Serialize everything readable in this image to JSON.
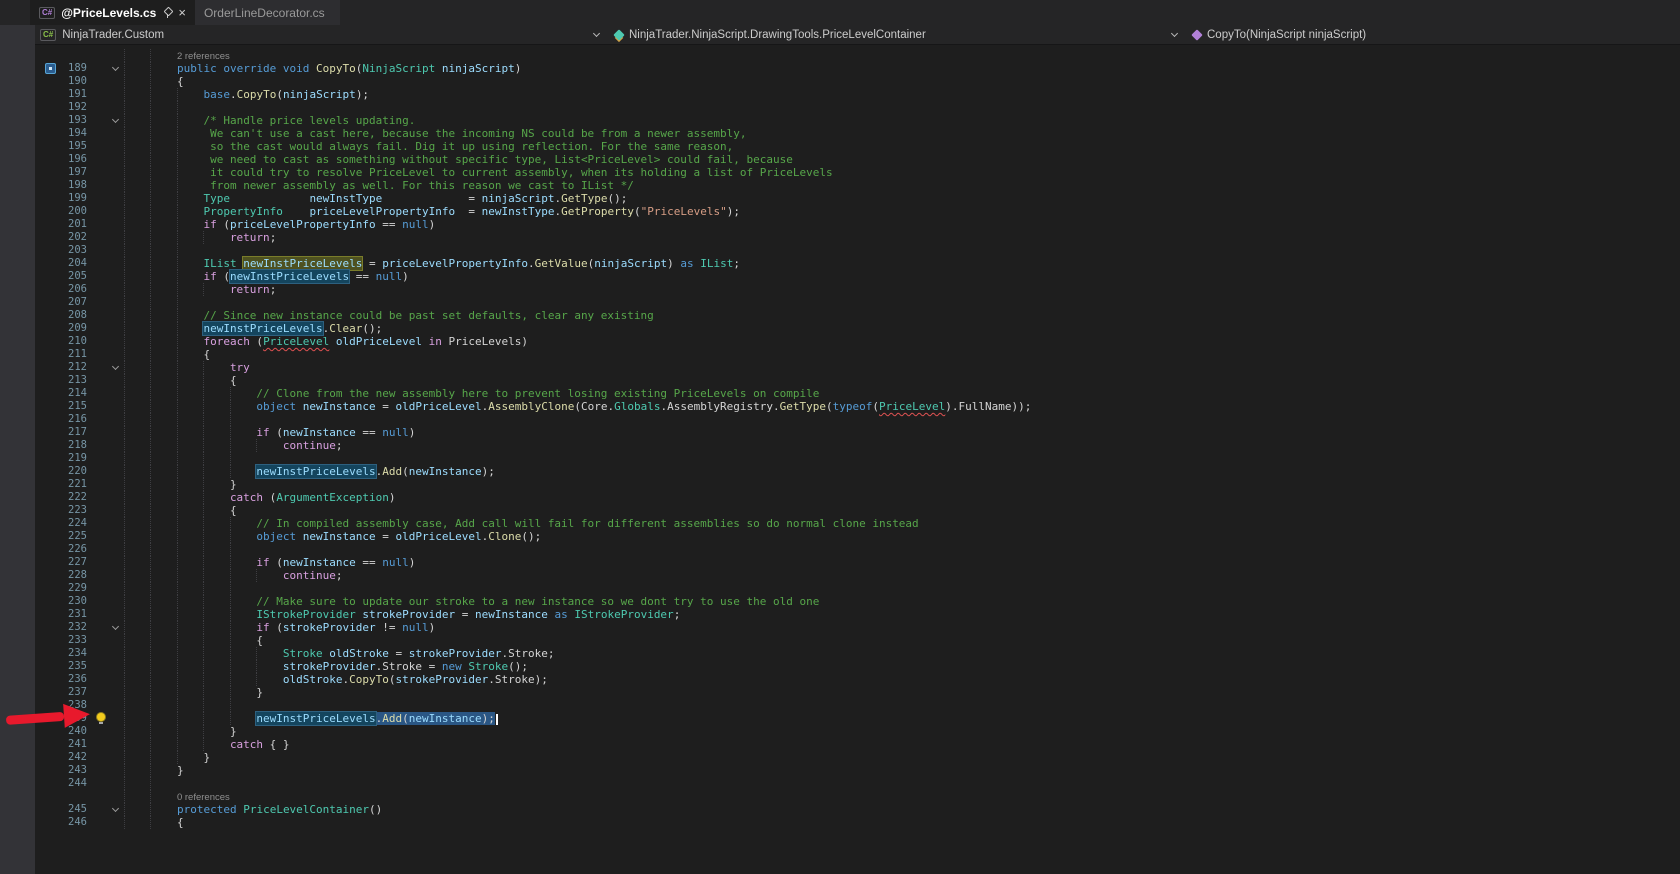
{
  "tabs": [
    {
      "label": "@PriceLevels.cs",
      "icon": "C#",
      "close_glyph": "×",
      "active": true,
      "pinned": true
    },
    {
      "label": "OrderLineDecorator.cs",
      "active": false
    }
  ],
  "navbar": {
    "project_icon": "C#",
    "project": "NinjaTrader.Custom",
    "type": "NinjaTrader.NinjaScript.DrawingTools.PriceLevelContainer",
    "member": "CopyTo(NinjaScript ninjaScript)"
  },
  "colors": {
    "red_arrow": "#e8192c",
    "selection": "#2a5684",
    "reference_highlight": "#14455e",
    "definition_highlight": "#4e5120",
    "comment": "#57a64a",
    "keyword": "#569cd6",
    "control_keyword": "#d8a0df",
    "type": "#4ec9b0",
    "method": "#dcdcaa",
    "variable": "#9cdcfe"
  },
  "editor": {
    "rows": [
      {
        "ann": "2 references",
        "ind": 2
      },
      {
        "n": 189,
        "fold": 1,
        "glyph": 1,
        "ind": 2,
        "t": [
          [
            "kw",
            "public override void "
          ],
          [
            "mth",
            "CopyTo"
          ],
          [
            "pln",
            "("
          ],
          [
            "typ",
            "NinjaScript"
          ],
          [
            "pln",
            " "
          ],
          [
            "var",
            "ninjaScript"
          ],
          [
            "pln",
            ")"
          ]
        ]
      },
      {
        "n": 190,
        "ind": 2,
        "t": [
          [
            "pln",
            "{"
          ]
        ]
      },
      {
        "n": 191,
        "ind": 3,
        "t": [
          [
            "kw",
            "base"
          ],
          [
            "pln",
            "."
          ],
          [
            "mth",
            "CopyTo"
          ],
          [
            "pln",
            "("
          ],
          [
            "var",
            "ninjaScript"
          ],
          [
            "pln",
            ");"
          ]
        ]
      },
      {
        "n": 192,
        "ind": 3,
        "t": []
      },
      {
        "n": 193,
        "fold": 1,
        "ind": 3,
        "t": [
          [
            "com",
            "/* Handle price levels updating."
          ]
        ]
      },
      {
        "n": 194,
        "ind": 3,
        "t": [
          [
            "com",
            " We can't use a cast here, because the incoming NS could be from a newer assembly,"
          ]
        ]
      },
      {
        "n": 195,
        "ind": 3,
        "t": [
          [
            "com",
            " so the cast would always fail. Dig it up using reflection. For the same reason,"
          ]
        ]
      },
      {
        "n": 196,
        "ind": 3,
        "t": [
          [
            "com",
            " we need to cast as something without specific type, List<PriceLevel> could fail, because"
          ]
        ]
      },
      {
        "n": 197,
        "ind": 3,
        "t": [
          [
            "com",
            " it could try to resolve PriceLevel to current assembly, when its holding a list of PriceLevels"
          ]
        ]
      },
      {
        "n": 198,
        "ind": 3,
        "t": [
          [
            "com",
            " from newer assembly as well. For this reason we cast to IList */"
          ]
        ]
      },
      {
        "n": 199,
        "ind": 3,
        "t": [
          [
            "typ",
            "Type"
          ],
          [
            "pln",
            "            "
          ],
          [
            "var",
            "newInstType"
          ],
          [
            "pln",
            "             = "
          ],
          [
            "var",
            "ninjaScript"
          ],
          [
            "pln",
            "."
          ],
          [
            "mth",
            "GetType"
          ],
          [
            "pln",
            "();"
          ]
        ]
      },
      {
        "n": 200,
        "ind": 3,
        "t": [
          [
            "typ",
            "PropertyInfo"
          ],
          [
            "pln",
            "    "
          ],
          [
            "var",
            "priceLevelPropertyInfo"
          ],
          [
            "pln",
            "  = "
          ],
          [
            "var",
            "newInstType"
          ],
          [
            "pln",
            "."
          ],
          [
            "mth",
            "GetProperty"
          ],
          [
            "pln",
            "("
          ],
          [
            "str",
            "\"PriceLevels\""
          ],
          [
            "pln",
            ");"
          ]
        ]
      },
      {
        "n": 201,
        "ind": 3,
        "t": [
          [
            "ctl",
            "if"
          ],
          [
            "pln",
            " ("
          ],
          [
            "var",
            "priceLevelPropertyInfo"
          ],
          [
            "pln",
            " == "
          ],
          [
            "kw",
            "null"
          ],
          [
            "pln",
            ")"
          ]
        ]
      },
      {
        "n": 202,
        "ind": 4,
        "t": [
          [
            "ctl",
            "return"
          ],
          [
            "pln",
            ";"
          ]
        ]
      },
      {
        "n": 203,
        "ind": 3,
        "t": []
      },
      {
        "n": 204,
        "ind": 3,
        "t": [
          [
            "typ",
            "IList"
          ],
          [
            "pln",
            " "
          ],
          [
            "var defhl",
            "newInstPriceLevels"
          ],
          [
            "pln",
            " = "
          ],
          [
            "var",
            "priceLevelPropertyInfo"
          ],
          [
            "pln",
            "."
          ],
          [
            "mth",
            "GetValue"
          ],
          [
            "pln",
            "("
          ],
          [
            "var",
            "ninjaScript"
          ],
          [
            "pln",
            ") "
          ],
          [
            "kw",
            "as"
          ],
          [
            "pln",
            " "
          ],
          [
            "typ",
            "IList"
          ],
          [
            "pln",
            ";"
          ]
        ]
      },
      {
        "n": 205,
        "ind": 3,
        "t": [
          [
            "ctl",
            "if"
          ],
          [
            "pln",
            " ("
          ],
          [
            "var refhl",
            "newInstPriceLevels"
          ],
          [
            "pln",
            " == "
          ],
          [
            "kw",
            "null"
          ],
          [
            "pln",
            ")"
          ]
        ]
      },
      {
        "n": 206,
        "ind": 4,
        "t": [
          [
            "ctl",
            "return"
          ],
          [
            "pln",
            ";"
          ]
        ]
      },
      {
        "n": 207,
        "ind": 3,
        "t": []
      },
      {
        "n": 208,
        "ind": 3,
        "t": [
          [
            "com",
            "// Since new instance could be past set defaults, clear any existing"
          ]
        ]
      },
      {
        "n": 209,
        "ind": 3,
        "t": [
          [
            "var refhl",
            "newInstPriceLevels"
          ],
          [
            "pln",
            "."
          ],
          [
            "mth",
            "Clear"
          ],
          [
            "pln",
            "();"
          ]
        ]
      },
      {
        "n": 210,
        "ind": 3,
        "t": [
          [
            "ctl",
            "foreach"
          ],
          [
            "pln",
            " ("
          ],
          [
            "typ sqg",
            "PriceLevel"
          ],
          [
            "pln",
            " "
          ],
          [
            "var",
            "oldPriceLevel"
          ],
          [
            "pln",
            " "
          ],
          [
            "ctl",
            "in"
          ],
          [
            "pln",
            " "
          ],
          [
            "pln",
            "PriceLevels"
          ],
          [
            "pln",
            ")"
          ]
        ]
      },
      {
        "n": 211,
        "ind": 3,
        "t": [
          [
            "pln",
            "{"
          ]
        ]
      },
      {
        "n": 212,
        "fold": 1,
        "ind": 4,
        "t": [
          [
            "ctl",
            "try"
          ]
        ]
      },
      {
        "n": 213,
        "ind": 4,
        "t": [
          [
            "pln",
            "{"
          ]
        ]
      },
      {
        "n": 214,
        "ind": 5,
        "t": [
          [
            "com",
            "// Clone from the new assembly here to prevent losing existing PriceLevels on compile"
          ]
        ]
      },
      {
        "n": 215,
        "ind": 5,
        "t": [
          [
            "kw",
            "object"
          ],
          [
            "pln",
            " "
          ],
          [
            "var",
            "newInstance"
          ],
          [
            "pln",
            " = "
          ],
          [
            "var",
            "oldPriceLevel"
          ],
          [
            "pln",
            "."
          ],
          [
            "mth",
            "AssemblyClone"
          ],
          [
            "pln",
            "("
          ],
          [
            "pln",
            "Core"
          ],
          [
            "pln",
            "."
          ],
          [
            "typ",
            "Globals"
          ],
          [
            "pln",
            "."
          ],
          [
            "pln",
            "AssemblyRegistry"
          ],
          [
            "pln",
            "."
          ],
          [
            "mth",
            "GetType"
          ],
          [
            "pln",
            "("
          ],
          [
            "kw",
            "typeof"
          ],
          [
            "pln",
            "("
          ],
          [
            "typ sqg",
            "PriceLevel"
          ],
          [
            "pln",
            ")."
          ],
          [
            "pln",
            "FullName"
          ],
          [
            "pln",
            "));"
          ]
        ]
      },
      {
        "n": 216,
        "ind": 5,
        "t": []
      },
      {
        "n": 217,
        "ind": 5,
        "t": [
          [
            "ctl",
            "if"
          ],
          [
            "pln",
            " ("
          ],
          [
            "var",
            "newInstance"
          ],
          [
            "pln",
            " == "
          ],
          [
            "kw",
            "null"
          ],
          [
            "pln",
            ")"
          ]
        ]
      },
      {
        "n": 218,
        "ind": 6,
        "t": [
          [
            "ctl",
            "continue"
          ],
          [
            "pln",
            ";"
          ]
        ]
      },
      {
        "n": 219,
        "ind": 5,
        "t": []
      },
      {
        "n": 220,
        "ind": 5,
        "t": [
          [
            "var refhl",
            "newInstPriceLevels"
          ],
          [
            "pln",
            "."
          ],
          [
            "mth",
            "Add"
          ],
          [
            "pln",
            "("
          ],
          [
            "var",
            "newInstance"
          ],
          [
            "pln",
            ");"
          ]
        ]
      },
      {
        "n": 221,
        "ind": 4,
        "t": [
          [
            "pln",
            "}"
          ]
        ]
      },
      {
        "n": 222,
        "ind": 4,
        "t": [
          [
            "ctl",
            "catch"
          ],
          [
            "pln",
            " ("
          ],
          [
            "typ",
            "ArgumentException"
          ],
          [
            "pln",
            ")"
          ]
        ]
      },
      {
        "n": 223,
        "ind": 4,
        "t": [
          [
            "pln",
            "{"
          ]
        ]
      },
      {
        "n": 224,
        "ind": 5,
        "t": [
          [
            "com",
            "// In compiled assembly case, Add call will fail for different assemblies so do normal clone instead"
          ]
        ]
      },
      {
        "n": 225,
        "ind": 5,
        "t": [
          [
            "kw",
            "object"
          ],
          [
            "pln",
            " "
          ],
          [
            "var",
            "newInstance"
          ],
          [
            "pln",
            " = "
          ],
          [
            "var",
            "oldPriceLevel"
          ],
          [
            "pln",
            "."
          ],
          [
            "mth",
            "Clone"
          ],
          [
            "pln",
            "();"
          ]
        ]
      },
      {
        "n": 226,
        "ind": 5,
        "t": []
      },
      {
        "n": 227,
        "ind": 5,
        "t": [
          [
            "ctl",
            "if"
          ],
          [
            "pln",
            " ("
          ],
          [
            "var",
            "newInstance"
          ],
          [
            "pln",
            " == "
          ],
          [
            "kw",
            "null"
          ],
          [
            "pln",
            ")"
          ]
        ]
      },
      {
        "n": 228,
        "ind": 6,
        "t": [
          [
            "ctl",
            "continue"
          ],
          [
            "pln",
            ";"
          ]
        ]
      },
      {
        "n": 229,
        "ind": 5,
        "t": []
      },
      {
        "n": 230,
        "ind": 5,
        "t": [
          [
            "com",
            "// Make sure to update our stroke to a new instance so we dont try to use the old one"
          ]
        ]
      },
      {
        "n": 231,
        "ind": 5,
        "t": [
          [
            "typ",
            "IStrokeProvider"
          ],
          [
            "pln",
            " "
          ],
          [
            "var",
            "strokeProvider"
          ],
          [
            "pln",
            " = "
          ],
          [
            "var",
            "newInstance"
          ],
          [
            "pln",
            " "
          ],
          [
            "kw",
            "as"
          ],
          [
            "pln",
            " "
          ],
          [
            "typ",
            "IStrokeProvider"
          ],
          [
            "pln",
            ";"
          ]
        ]
      },
      {
        "n": 232,
        "fold": 1,
        "ind": 5,
        "t": [
          [
            "ctl",
            "if"
          ],
          [
            "pln",
            " ("
          ],
          [
            "var",
            "strokeProvider"
          ],
          [
            "pln",
            " != "
          ],
          [
            "kw",
            "null"
          ],
          [
            "pln",
            ")"
          ]
        ]
      },
      {
        "n": 233,
        "ind": 5,
        "t": [
          [
            "pln",
            "{"
          ]
        ]
      },
      {
        "n": 234,
        "ind": 6,
        "t": [
          [
            "typ",
            "Stroke"
          ],
          [
            "pln",
            " "
          ],
          [
            "var",
            "oldStroke"
          ],
          [
            "pln",
            " = "
          ],
          [
            "var",
            "strokeProvider"
          ],
          [
            "pln",
            "."
          ],
          [
            "pln",
            "Stroke"
          ],
          [
            "pln",
            ";"
          ]
        ]
      },
      {
        "n": 235,
        "ind": 6,
        "t": [
          [
            "var",
            "strokeProvider"
          ],
          [
            "pln",
            "."
          ],
          [
            "pln",
            "Stroke"
          ],
          [
            "pln",
            " = "
          ],
          [
            "kw",
            "new"
          ],
          [
            "pln",
            " "
          ],
          [
            "typ",
            "Stroke"
          ],
          [
            "pln",
            "();"
          ]
        ]
      },
      {
        "n": 236,
        "ind": 6,
        "t": [
          [
            "var",
            "oldStroke"
          ],
          [
            "pln",
            "."
          ],
          [
            "mth",
            "CopyTo"
          ],
          [
            "pln",
            "("
          ],
          [
            "var",
            "strokeProvider"
          ],
          [
            "pln",
            "."
          ],
          [
            "pln",
            "Stroke"
          ],
          [
            "pln",
            ");"
          ]
        ]
      },
      {
        "n": 237,
        "ind": 5,
        "t": [
          [
            "pln",
            "}"
          ]
        ]
      },
      {
        "n": 238,
        "ind": 5,
        "t": []
      },
      {
        "n": 239,
        "bulb": 1,
        "ind": 5,
        "t": [
          [
            "var refhl",
            "newInstPriceLevels"
          ],
          [
            "pln sel",
            "."
          ],
          [
            "mth sel",
            "Add"
          ],
          [
            "pln sel",
            "("
          ],
          [
            "var sel",
            "newInstance"
          ],
          [
            "pln sel",
            ");"
          ],
          [
            "caret",
            ""
          ]
        ]
      },
      {
        "n": 240,
        "ind": 4,
        "t": [
          [
            "pln",
            "}"
          ]
        ]
      },
      {
        "n": 241,
        "ind": 4,
        "t": [
          [
            "ctl",
            "catch"
          ],
          [
            "pln",
            " { }"
          ]
        ]
      },
      {
        "n": 242,
        "ind": 3,
        "t": [
          [
            "pln",
            "}"
          ]
        ]
      },
      {
        "n": 243,
        "ind": 2,
        "t": [
          [
            "pln",
            "}"
          ]
        ]
      },
      {
        "n": 244,
        "ind": 2,
        "t": []
      },
      {
        "ann": "0 references",
        "ind": 2
      },
      {
        "n": 245,
        "fold": 1,
        "ind": 2,
        "t": [
          [
            "kw",
            "protected"
          ],
          [
            "pln",
            " "
          ],
          [
            "typ",
            "PriceLevelContainer"
          ],
          [
            "pln",
            "()"
          ]
        ]
      },
      {
        "n": 246,
        "ind": 2,
        "t": [
          [
            "pln",
            "{"
          ]
        ]
      }
    ]
  }
}
